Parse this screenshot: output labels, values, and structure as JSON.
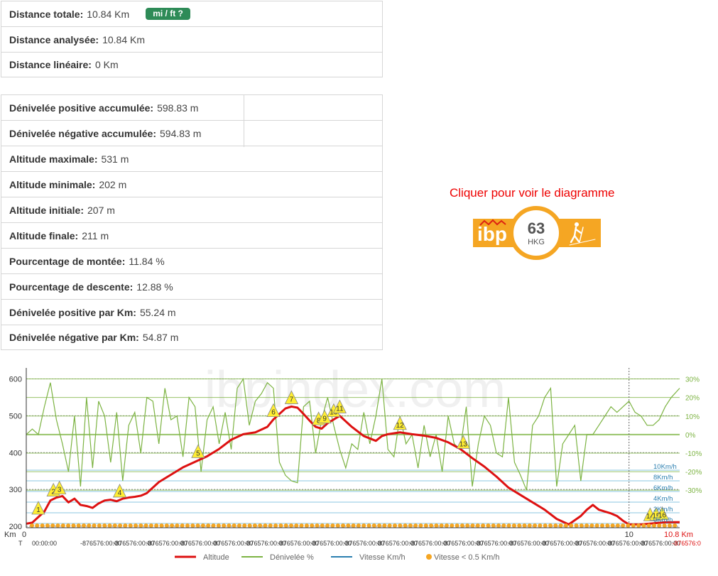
{
  "stats1": [
    {
      "label": "Distance totale:",
      "value": "10.84 Km"
    },
    {
      "label": "Distance analysée:",
      "value": "10.84 Km"
    },
    {
      "label": "Distance linéaire:",
      "value": "0 Km"
    }
  ],
  "unit_button": "mi / ft ?",
  "stats2": [
    {
      "label": "Dénivelée positive accumulée:",
      "value": "598.83 m"
    },
    {
      "label": "Dénivelée négative accumulée:",
      "value": "594.83 m"
    },
    {
      "label": "Altitude maximale:",
      "value": "531 m"
    },
    {
      "label": "Altitude minimale:",
      "value": "202 m"
    },
    {
      "label": "Altitude initiale:",
      "value": "207 m"
    },
    {
      "label": "Altitude finale:",
      "value": "211 m"
    },
    {
      "label": "Pourcentage de montée:",
      "value": "11.84 %"
    },
    {
      "label": "Pourcentage de descente:",
      "value": "12.88 %"
    },
    {
      "label": "Dénivelée positive par Km:",
      "value": "55.24 m"
    },
    {
      "label": "Dénivelée négative par Km:",
      "value": "54.87 m"
    }
  ],
  "ibp": {
    "link_text": "Cliquer pour voir le diagramme",
    "logo_text": "ibp",
    "score": "63",
    "code": "HKG"
  },
  "colors": {
    "altitude": "#dd1111",
    "slope": "#7cb342",
    "speed": "#2a7fb0",
    "stopped": "#f5a623",
    "button": "#2e8b57",
    "ibp": "#f5a623"
  },
  "chart_data": {
    "type": "line",
    "watermark": "ibpindex.com",
    "x_axis": {
      "unit_label": "Km",
      "time_label": "T",
      "ticks": [
        "0",
        "10"
      ],
      "end_label": "10.8 Km",
      "xlim": [
        0,
        10.84
      ]
    },
    "time_labels": [
      "00:00:00",
      "-876576:00:00",
      "-876576:00:00",
      "-876576:00:00",
      "-876576:00:00",
      "-876576:00:00",
      "-876576:00:00",
      "-876576:00:00",
      "-876576:00:00",
      "-876576:00:00",
      "-876576:00:00",
      "-876576:00:00",
      "-876576:00:00",
      "-876576:00:00",
      "-876576:00:00",
      "-876576:00:00",
      "-876576:00:00",
      "-876576:00:00",
      "-876576:00:00",
      "-876576:0"
    ],
    "y_left": {
      "ticks": [
        "600",
        "500",
        "400",
        "300",
        "200"
      ],
      "ylim": [
        200,
        630
      ]
    },
    "y_slope": {
      "ticks": [
        "30%",
        "20%",
        "10%",
        "0%",
        "-10%",
        "-20%",
        "-30%"
      ],
      "ylim": [
        -45,
        33
      ]
    },
    "y_speed": {
      "ticks": [
        "10Km/h",
        "8Km/h",
        "6Km/h",
        "4Km/h",
        "2Km/h",
        "0Km/h"
      ]
    },
    "legend": [
      "Altitude",
      "Dénivelée %",
      "Vitesse Km/h",
      "Vitesse < 0.5 Km/h"
    ],
    "altitude": {
      "x": [
        0,
        0.1,
        0.2,
        0.3,
        0.4,
        0.5,
        0.6,
        0.7,
        0.8,
        0.9,
        1.0,
        1.1,
        1.2,
        1.3,
        1.4,
        1.5,
        1.6,
        1.7,
        1.8,
        1.9,
        2.0,
        2.2,
        2.4,
        2.6,
        2.8,
        3.0,
        3.2,
        3.4,
        3.6,
        3.8,
        4.0,
        4.1,
        4.2,
        4.3,
        4.4,
        4.5,
        4.6,
        4.7,
        4.8,
        4.9,
        5.0,
        5.2,
        5.4,
        5.6,
        5.8,
        5.9,
        6.0,
        6.2,
        6.4,
        6.6,
        6.8,
        7.0,
        7.2,
        7.4,
        7.6,
        7.8,
        8.0,
        8.2,
        8.4,
        8.6,
        8.8,
        9.0,
        9.2,
        9.3,
        9.4,
        9.5,
        9.6,
        9.7,
        9.8,
        9.9,
        10.0,
        10.2,
        10.4,
        10.6,
        10.84
      ],
      "y": [
        207,
        210,
        225,
        240,
        270,
        278,
        282,
        265,
        275,
        258,
        255,
        250,
        262,
        270,
        272,
        268,
        275,
        278,
        280,
        283,
        290,
        320,
        340,
        360,
        375,
        390,
        410,
        435,
        450,
        455,
        470,
        490,
        505,
        520,
        525,
        522,
        505,
        487,
        470,
        465,
        480,
        500,
        470,
        445,
        432,
        445,
        450,
        455,
        450,
        446,
        440,
        428,
        410,
        385,
        362,
        335,
        305,
        285,
        265,
        245,
        220,
        205,
        228,
        245,
        258,
        245,
        240,
        235,
        228,
        215,
        205,
        205,
        208,
        211,
        211
      ]
    },
    "slope": {
      "x": [
        0,
        0.1,
        0.2,
        0.3,
        0.4,
        0.5,
        0.6,
        0.7,
        0.8,
        0.9,
        1.0,
        1.1,
        1.2,
        1.3,
        1.4,
        1.5,
        1.6,
        1.7,
        1.8,
        1.9,
        2.0,
        2.1,
        2.2,
        2.3,
        2.4,
        2.5,
        2.6,
        2.7,
        2.8,
        2.9,
        3.0,
        3.1,
        3.2,
        3.3,
        3.4,
        3.5,
        3.6,
        3.7,
        3.8,
        3.9,
        4.0,
        4.1,
        4.2,
        4.3,
        4.4,
        4.5,
        4.6,
        4.7,
        4.8,
        4.9,
        5.0,
        5.1,
        5.2,
        5.3,
        5.4,
        5.5,
        5.6,
        5.7,
        5.8,
        5.9,
        6.0,
        6.1,
        6.2,
        6.3,
        6.4,
        6.5,
        6.6,
        6.7,
        6.8,
        6.9,
        7.0,
        7.1,
        7.2,
        7.3,
        7.4,
        7.5,
        7.6,
        7.7,
        7.8,
        7.9,
        8.0,
        8.1,
        8.2,
        8.3,
        8.4,
        8.5,
        8.6,
        8.7,
        8.8,
        8.9,
        9.0,
        9.1,
        9.2,
        9.3,
        9.4,
        9.5,
        9.6,
        9.7,
        9.8,
        9.9,
        10.0,
        10.1,
        10.2,
        10.3,
        10.4,
        10.5,
        10.6,
        10.7,
        10.84
      ],
      "y": [
        0,
        3,
        0,
        15,
        28,
        8,
        -5,
        -20,
        10,
        -28,
        20,
        -18,
        18,
        10,
        -15,
        12,
        -25,
        5,
        12,
        -10,
        20,
        18,
        -5,
        25,
        8,
        10,
        -12,
        20,
        15,
        -20,
        8,
        15,
        -5,
        12,
        -8,
        25,
        30,
        5,
        18,
        22,
        28,
        25,
        -15,
        -22,
        -25,
        -26,
        15,
        18,
        -10,
        8,
        20,
        5,
        -8,
        -18,
        -5,
        -8,
        12,
        -5,
        10,
        30,
        -8,
        -12,
        10,
        -5,
        0,
        -18,
        5,
        -12,
        0,
        -20,
        10,
        -5,
        -8,
        15,
        -28,
        -5,
        10,
        5,
        -10,
        -12,
        20,
        -15,
        -22,
        -30,
        5,
        10,
        20,
        25,
        -28,
        -5,
        0,
        5,
        -25,
        0,
        0,
        5,
        10,
        15,
        12,
        15,
        18,
        12,
        10,
        5,
        5,
        8,
        15,
        20,
        25
      ]
    },
    "waypoints": [
      {
        "label": "1",
        "x": 0.2
      },
      {
        "label": "2",
        "x": 0.45
      },
      {
        "label": "3",
        "x": 0.55
      },
      {
        "label": "4",
        "x": 1.55
      },
      {
        "label": "5",
        "x": 2.85
      },
      {
        "label": "6",
        "x": 4.1
      },
      {
        "label": "7",
        "x": 4.4
      },
      {
        "label": "8",
        "x": 4.85
      },
      {
        "label": "9",
        "x": 4.95
      },
      {
        "label": "10",
        "x": 5.1
      },
      {
        "label": "11",
        "x": 5.2
      },
      {
        "label": "12",
        "x": 6.2
      },
      {
        "label": "13",
        "x": 7.25
      },
      {
        "label": "14",
        "x": 10.35
      },
      {
        "label": "15",
        "x": 10.45
      },
      {
        "label": "16",
        "x": 10.55
      }
    ]
  }
}
